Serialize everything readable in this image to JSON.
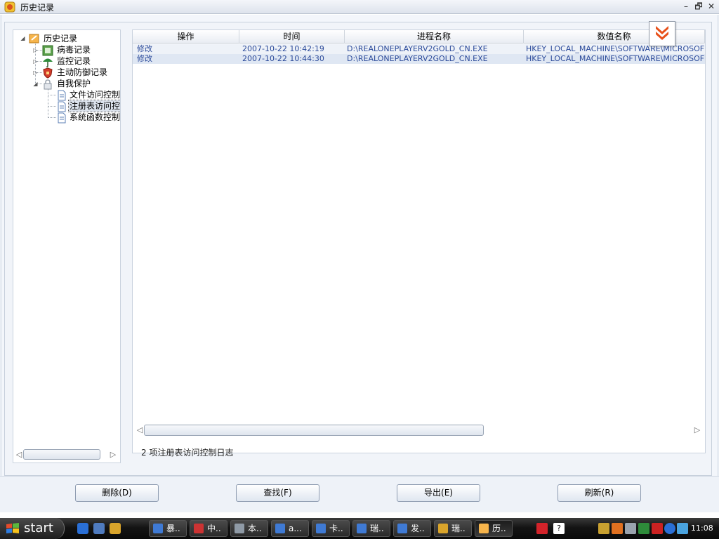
{
  "window": {
    "title": "历史记录",
    "controls": {
      "minimize": "–",
      "restore": "🗗",
      "close": "✕"
    }
  },
  "tree": {
    "root": "历史记录",
    "items": [
      {
        "label": "病毒记录",
        "icon": "virus-record-icon"
      },
      {
        "label": "监控记录",
        "icon": "monitor-umbrella-icon"
      },
      {
        "label": "主动防御记录",
        "icon": "shield-icon"
      },
      {
        "label": "自我保护",
        "icon": "lock-icon"
      }
    ],
    "children": [
      {
        "label": "文件访问控制",
        "icon": "document-icon"
      },
      {
        "label": "注册表访问控",
        "icon": "document-icon"
      },
      {
        "label": "系统函数控制",
        "icon": "document-icon"
      }
    ]
  },
  "list": {
    "columns": [
      "操作",
      "时间",
      "进程名称",
      "数值名称"
    ],
    "rows": [
      [
        "修改",
        "2007-10-22 10:42:19",
        "D:\\REALONEPLAYERV2GOLD_CN.EXE",
        "HKEY_LOCAL_MACHINE\\SOFTWARE\\MICROSOFT..."
      ],
      [
        "修改",
        "2007-10-22 10:44:30",
        "D:\\REALONEPLAYERV2GOLD_CN.EXE",
        "HKEY_LOCAL_MACHINE\\SOFTWARE\\MICROSOFT..."
      ]
    ]
  },
  "status": "2 项注册表访问控制日志",
  "buttons": {
    "delete": "删除(D)",
    "find": "查找(F)",
    "export": "导出(E)",
    "refresh": "刷新(R)"
  },
  "taskbar": {
    "start": "start",
    "tasks": [
      "暴..",
      "中..",
      "本..",
      "a...",
      "卡..",
      "瑞..",
      "发..",
      "瑞..",
      "历.."
    ],
    "clock": "11:08"
  },
  "colors": {
    "accent": "#e8501a",
    "row_text": "#2b4a9a",
    "taskbar": "#141414"
  }
}
